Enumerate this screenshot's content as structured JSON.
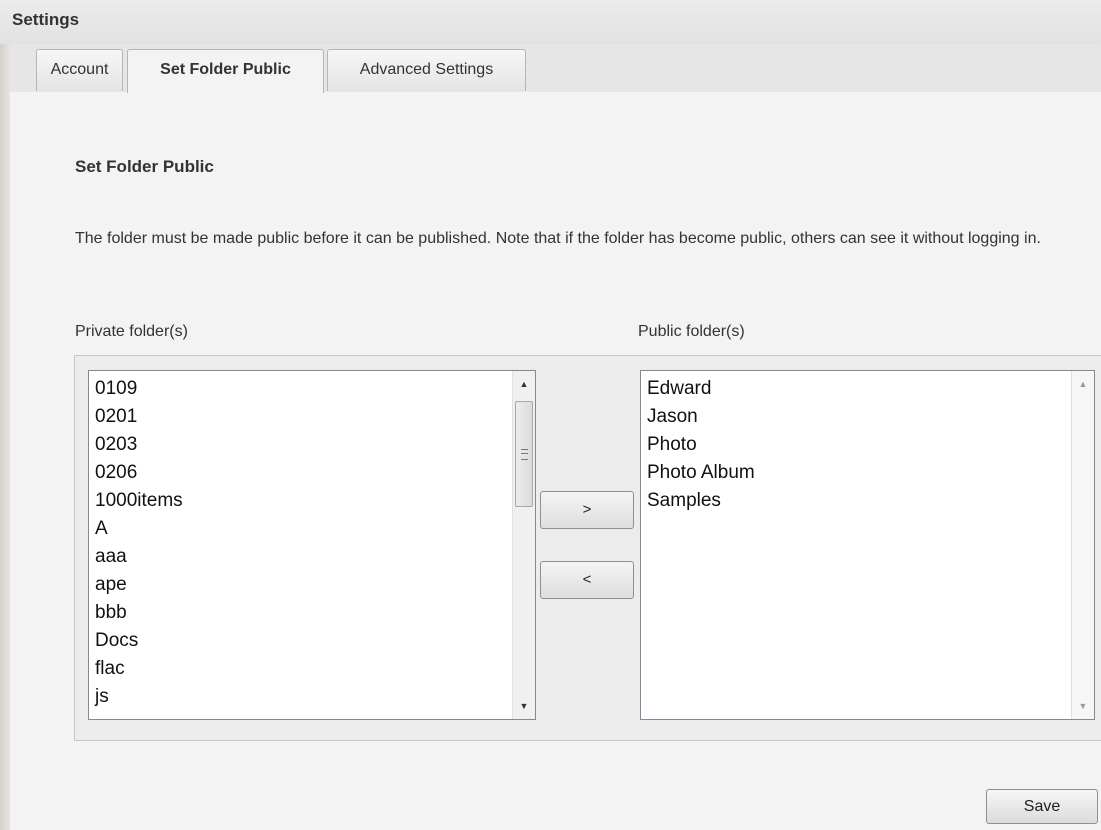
{
  "window": {
    "title": "Settings"
  },
  "tabs": [
    {
      "label": "Account"
    },
    {
      "label": "Set Folder Public"
    },
    {
      "label": "Advanced Settings"
    }
  ],
  "active_tab": "Set Folder Public",
  "section": {
    "heading": "Set Folder Public",
    "description": "The folder must be made public before it can be published. Note that if the folder has become public, others can see it without logging in."
  },
  "private_list": {
    "label": "Private folder(s)",
    "items": [
      "0109",
      "0201",
      "0203",
      "0206",
      "1000items",
      "A",
      "aaa",
      "ape",
      "bbb",
      "Docs",
      "flac",
      "js"
    ]
  },
  "public_list": {
    "label": "Public folder(s)",
    "items": [
      "Edward",
      "Jason",
      "Photo",
      "Photo Album",
      "Samples"
    ]
  },
  "buttons": {
    "move_to_public": ">",
    "move_to_private": "<",
    "save": "Save"
  },
  "icons": {
    "scroll_up": "scroll-up-arrow-icon",
    "scroll_down": "scroll-down-arrow-icon",
    "scroll_grip": "scroll-grip-icon"
  }
}
